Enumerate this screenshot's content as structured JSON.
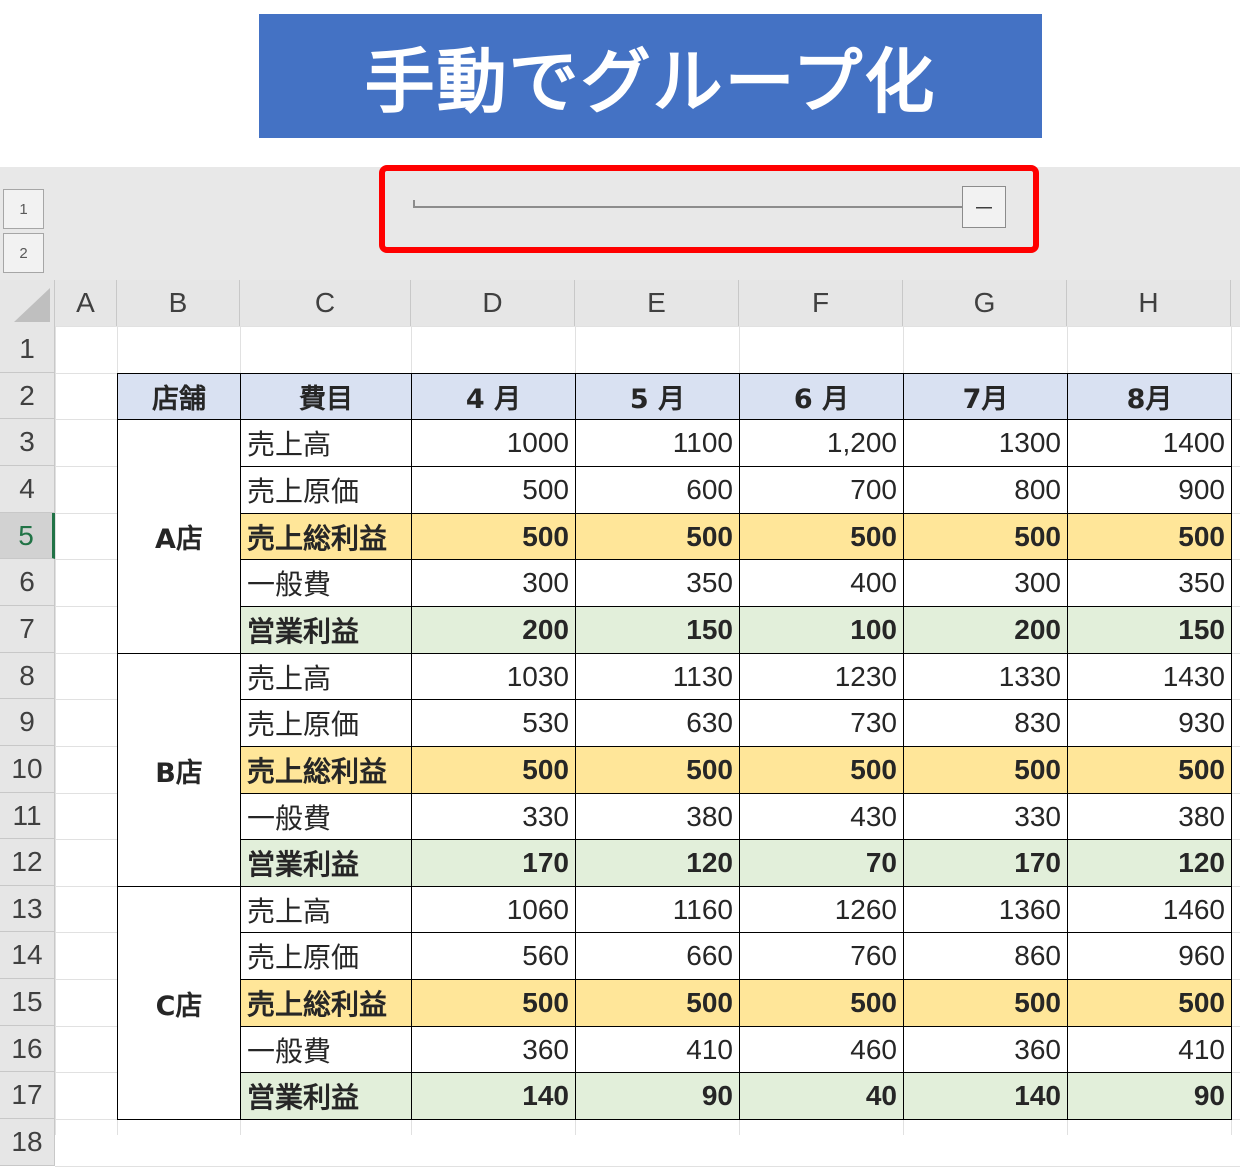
{
  "title": "手動でグループ化",
  "outline": {
    "levels": [
      "1",
      "2"
    ],
    "collapse_symbol": "－"
  },
  "columns": [
    "A",
    "B",
    "C",
    "D",
    "E",
    "F",
    "G",
    "H"
  ],
  "rows": [
    "1",
    "2",
    "3",
    "4",
    "5",
    "6",
    "7",
    "8",
    "9",
    "10",
    "11",
    "12",
    "13",
    "14",
    "15",
    "16",
    "17",
    "18"
  ],
  "active_row": "5",
  "table": {
    "headers": [
      "店舗",
      "費目",
      "4 月",
      "5 月",
      "6 月",
      "7月",
      "8月"
    ],
    "stores": [
      {
        "name": "A店",
        "rows": [
          {
            "label": "売上高",
            "type": "normal",
            "values": [
              "1000",
              "1100",
              "1,200",
              "1300",
              "1400"
            ]
          },
          {
            "label": "売上原価",
            "type": "normal",
            "values": [
              "500",
              "600",
              "700",
              "800",
              "900"
            ]
          },
          {
            "label": "売上総利益",
            "type": "gross",
            "values": [
              "500",
              "500",
              "500",
              "500",
              "500"
            ]
          },
          {
            "label": "一般費",
            "type": "normal",
            "values": [
              "300",
              "350",
              "400",
              "300",
              "350"
            ]
          },
          {
            "label": "営業利益",
            "type": "operating",
            "values": [
              "200",
              "150",
              "100",
              "200",
              "150"
            ]
          }
        ]
      },
      {
        "name": "B店",
        "rows": [
          {
            "label": "売上高",
            "type": "normal",
            "values": [
              "1030",
              "1130",
              "1230",
              "1330",
              "1430"
            ]
          },
          {
            "label": "売上原価",
            "type": "normal",
            "values": [
              "530",
              "630",
              "730",
              "830",
              "930"
            ]
          },
          {
            "label": "売上総利益",
            "type": "gross",
            "values": [
              "500",
              "500",
              "500",
              "500",
              "500"
            ]
          },
          {
            "label": "一般費",
            "type": "normal",
            "values": [
              "330",
              "380",
              "430",
              "330",
              "380"
            ]
          },
          {
            "label": "営業利益",
            "type": "operating",
            "values": [
              "170",
              "120",
              "70",
              "170",
              "120"
            ]
          }
        ]
      },
      {
        "name": "C店",
        "rows": [
          {
            "label": "売上高",
            "type": "normal",
            "values": [
              "1060",
              "1160",
              "1260",
              "1360",
              "1460"
            ]
          },
          {
            "label": "売上原価",
            "type": "normal",
            "values": [
              "560",
              "660",
              "760",
              "860",
              "960"
            ]
          },
          {
            "label": "売上総利益",
            "type": "gross",
            "values": [
              "500",
              "500",
              "500",
              "500",
              "500"
            ]
          },
          {
            "label": "一般費",
            "type": "normal",
            "values": [
              "360",
              "410",
              "460",
              "360",
              "410"
            ]
          },
          {
            "label": "営業利益",
            "type": "operating",
            "values": [
              "140",
              "90",
              "40",
              "140",
              "90"
            ]
          }
        ]
      }
    ]
  },
  "colors": {
    "banner": "#4472c4",
    "header_fill": "#d9e1f2",
    "gross_fill": "#ffe699",
    "operating_fill": "#e2efda",
    "highlight": "#ff0000",
    "active": "#217346"
  }
}
